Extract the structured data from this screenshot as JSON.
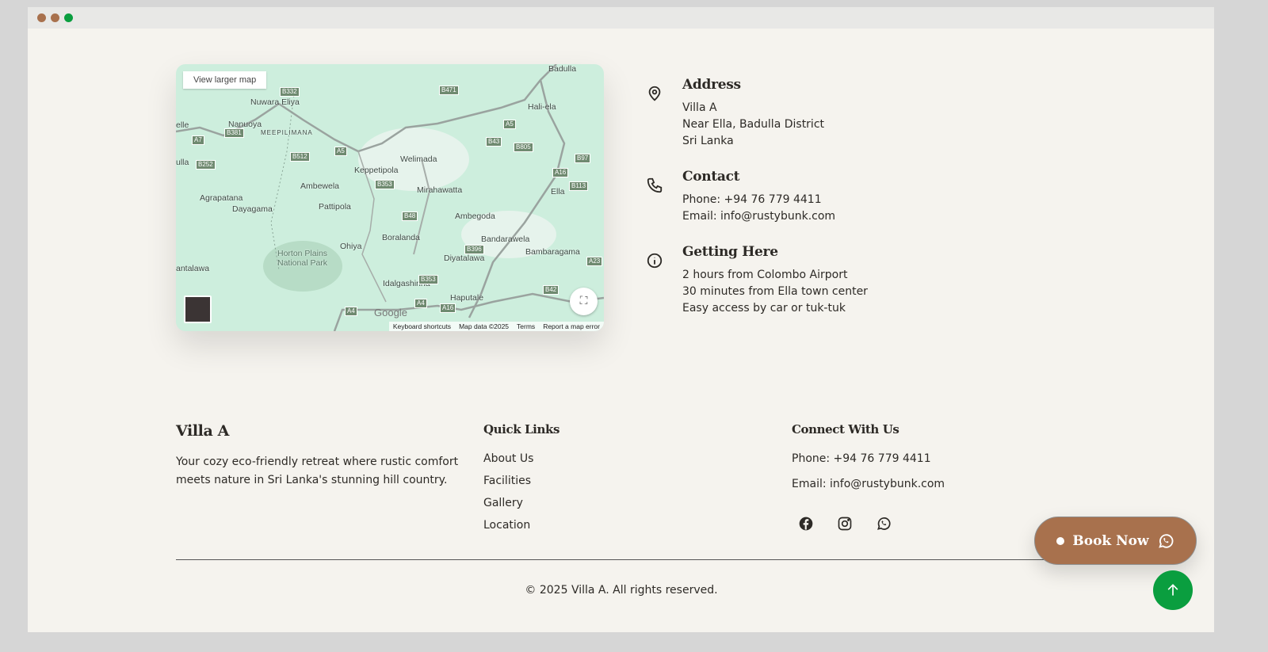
{
  "window": {
    "dots": [
      "#a8714d",
      "#a8714d",
      "#0a9e3f"
    ]
  },
  "map": {
    "view_larger": "View larger map",
    "places": [
      "Badulla",
      "Nuwara Eliya",
      "Hali-ela",
      "Nanuoya",
      "MEEPILIMANA",
      "Welimada",
      "Keppetipola",
      "Ambewela",
      "Mirahawatta",
      "Ella",
      "Agrapatana",
      "Dayagama",
      "Pattipola",
      "Ambegoda",
      "Boralanda",
      "Bandarawela",
      "Horton Plains National Park",
      "Ohiya",
      "Diyatalawa",
      "Bambaragama",
      "antalawa",
      "Idalgashinna",
      "Haputale",
      "ulla",
      "elle"
    ],
    "roads": [
      "B332",
      "B471",
      "B381",
      "A7",
      "A5",
      "B512",
      "B43",
      "B805",
      "B252",
      "A5",
      "B97",
      "B353",
      "A16",
      "B113",
      "B48",
      "B396",
      "A23",
      "B353",
      "B42",
      "A4",
      "A4",
      "A16"
    ],
    "google": "Google",
    "attribution": [
      "Keyboard shortcuts",
      "Map data ©2025",
      "Terms",
      "Report a map error"
    ]
  },
  "info": [
    {
      "icon": "map-pin-icon",
      "title": "Address",
      "lines": [
        "Villa A",
        "Near Ella, Badulla District",
        "Sri Lanka"
      ]
    },
    {
      "icon": "phone-icon",
      "title": "Contact",
      "lines": [
        "Phone: +94 76 779 4411",
        "Email: info@rustybunk.com"
      ]
    },
    {
      "icon": "info-icon",
      "title": "Getting Here",
      "lines": [
        "2 hours from Colombo Airport",
        "30 minutes from Ella town center",
        "Easy access by car or tuk-tuk"
      ]
    }
  ],
  "footer": {
    "brand": "Villa A",
    "tagline_1": "Your cozy eco-friendly retreat where rustic comfort",
    "tagline_2": "meets nature in Sri Lanka's stunning hill country.",
    "quick_links_title": "Quick Links",
    "quick_links": [
      "About Us",
      "Facilities",
      "Gallery",
      "Location"
    ],
    "connect_title": "Connect With Us",
    "phone": "Phone: +94 76 779 4411",
    "email": "Email: info@rustybunk.com",
    "social": [
      "facebook-icon",
      "instagram-icon",
      "whatsapp-icon"
    ],
    "copyright": "© 2025 Villa A. All rights reserved."
  },
  "book_now": "Book Now",
  "colors": {
    "accent": "#a8714d",
    "green": "#0a9e3f",
    "background": "#f5f3ee"
  }
}
